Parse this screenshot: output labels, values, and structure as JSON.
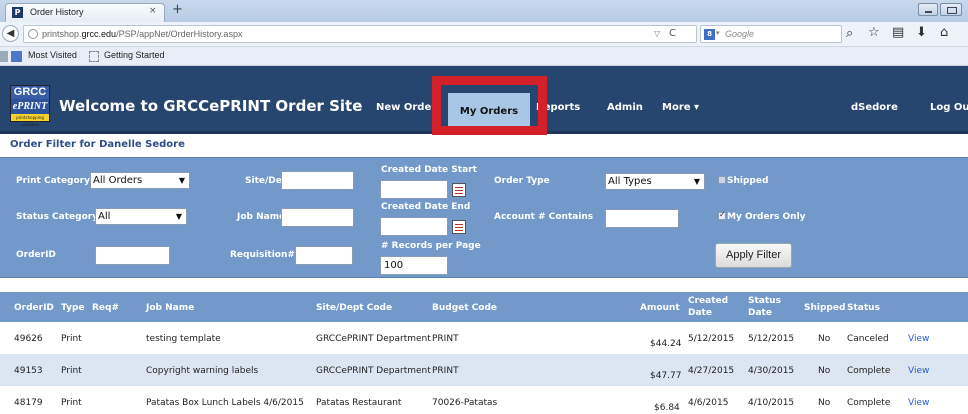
{
  "browser": {
    "tab_title": "Order History",
    "tab_icon": "P",
    "tab_close": "×",
    "new_tab": "+",
    "url_prefix": "printshop.",
    "url_domain": "grcc.edu",
    "url_path": "/PSP/appNet/OrderHistory.aspx",
    "search_engine_icon": "8",
    "search_placeholder": "Google",
    "bookmarks": [
      "Most Visited",
      "Getting Started"
    ]
  },
  "site": {
    "logo_top": "GRCC",
    "logo_mid": "ePRINT",
    "logo_tag": "printshopping solutions",
    "title": "Welcome to GRCCePRINT Order Site",
    "menu": {
      "new_order": "New Order",
      "my_orders": "My Orders",
      "reports": "Reports",
      "admin": "Admin",
      "more": "More ▾",
      "user": "dSedore",
      "logout": "Log Out"
    },
    "highlight_color": "#d4202a"
  },
  "filter": {
    "title": "Order Filter for Danelle Sedore",
    "print_category_label": "Print Category",
    "print_category_value": "All Orders",
    "status_category_label": "Status Category",
    "status_category_value": "All",
    "orderid_label": "OrderID",
    "site_dept_label": "Site/Dept",
    "job_name_label": "Job Name",
    "requisition_label": "Requisition#",
    "created_start_label": "Created Date Start",
    "created_end_label": "Created Date End",
    "records_label": "# Records per Page",
    "records_value": "100",
    "order_type_label": "Order Type",
    "order_type_value": "All Types",
    "account_label": "Account # Contains",
    "shipped_label": "Shipped",
    "my_orders_only_label": "My Orders Only",
    "apply_label": "Apply Filter"
  },
  "table": {
    "headers": {
      "orderid": "OrderID",
      "type": "Type",
      "req": "Req#",
      "job_name": "Job Name",
      "site": "Site/Dept Code",
      "budget": "Budget Code",
      "amount": "Amount",
      "created_1": "Created",
      "created_2": "Date",
      "status_date_1": "Status",
      "status_date_2": "Date",
      "shipped": "Shipped",
      "status": "Status"
    },
    "rows": [
      {
        "orderid": "49626",
        "type": "Print",
        "req": "",
        "job_name": "testing template",
        "site": "GRCCePRINT Department",
        "budget": "PRINT",
        "amount": "$44.24",
        "created": "5/12/2015",
        "status_date": "5/12/2015",
        "shipped": "No",
        "status": "Canceled",
        "action": "View"
      },
      {
        "orderid": "49153",
        "type": "Print",
        "req": "",
        "job_name": "Copyright warning labels",
        "site": "GRCCePRINT Department",
        "budget": "PRINT",
        "amount": "$47.77",
        "created": "4/27/2015",
        "status_date": "4/30/2015",
        "shipped": "No",
        "status": "Complete",
        "action": "View"
      },
      {
        "orderid": "48179",
        "type": "Print",
        "req": "",
        "job_name": "Patatas Box Lunch Labels 4/6/2015",
        "site": "Patatas Restaurant",
        "budget": "70026-Patatas",
        "amount": "$6.84",
        "created": "4/6/2015",
        "status_date": "4/10/2015",
        "shipped": "No",
        "status": "Complete",
        "action": "View"
      }
    ]
  }
}
